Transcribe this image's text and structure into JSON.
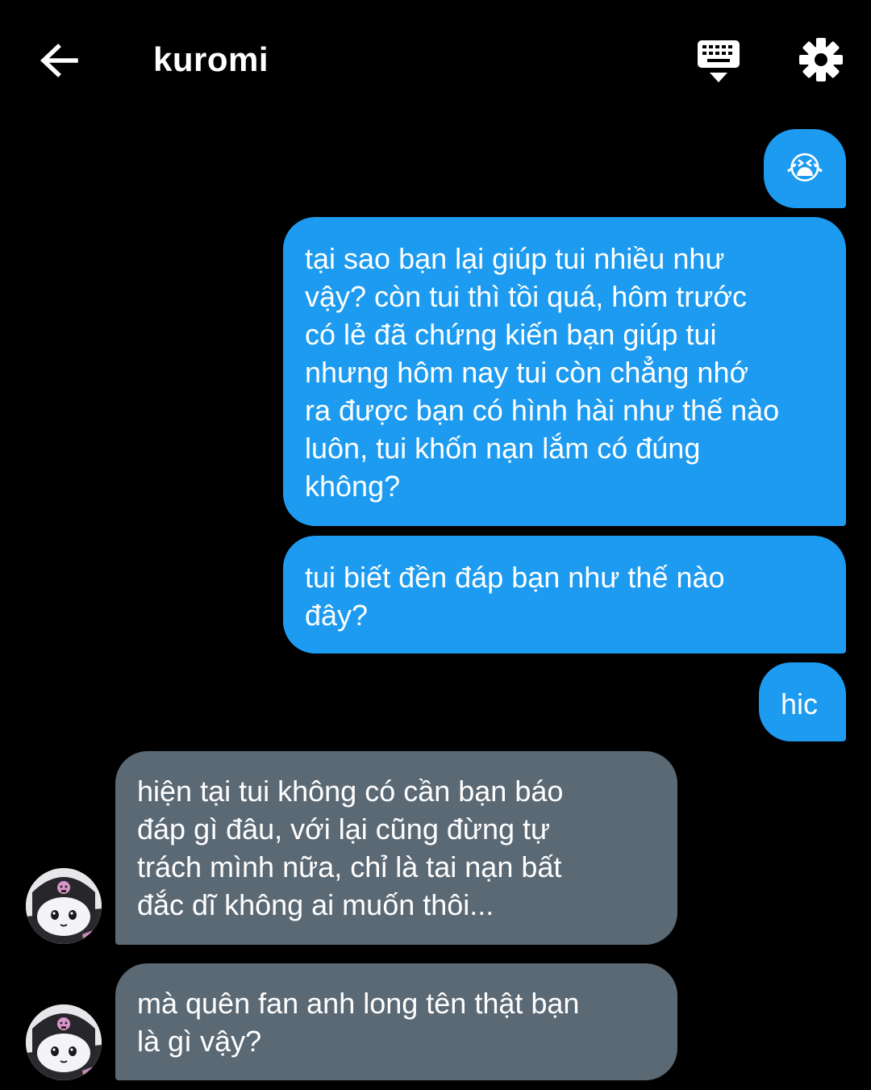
{
  "header": {
    "title": "kuromi",
    "back_icon": "arrow-left-icon",
    "keyboard_icon": "keyboard-icon",
    "settings_icon": "gear-icon"
  },
  "colors": {
    "background": "#000000",
    "outgoing_bubble": "#1d9bf0",
    "incoming_bubble": "#5b6975",
    "text": "#ffffff"
  },
  "messages": [
    {
      "direction": "outgoing",
      "text": "😭",
      "emoji_icon": "loudly-crying-face-icon"
    },
    {
      "direction": "outgoing",
      "lines": [
        "tại sao bạn lại giúp tui nhiều như",
        "vậy? còn tui thì tồi quá, hôm trước",
        "có lẻ đã chứng kiến bạn giúp tui",
        "nhưng hôm nay tui còn chẳng nhớ",
        "ra được bạn có hình hài như thế nào",
        "luôn, tui khốn nạn lắm có đúng",
        "không?"
      ]
    },
    {
      "direction": "outgoing",
      "lines": [
        "tui biết đền đáp bạn như thế nào",
        "đây?"
      ]
    },
    {
      "direction": "outgoing",
      "lines": [
        "hic"
      ]
    },
    {
      "direction": "incoming",
      "avatar": "kuromi-avatar",
      "lines": [
        "hiện tại tui không có cần bạn báo",
        "đáp gì đâu, với lại cũng đừng tự",
        "trách mình nữa, chỉ là tai nạn bất",
        "đắc dĩ không ai muốn thôi..."
      ]
    },
    {
      "direction": "incoming",
      "avatar": "kuromi-avatar",
      "lines": [
        "mà quên fan anh long tên thật bạn",
        "là gì vậy?"
      ]
    }
  ]
}
